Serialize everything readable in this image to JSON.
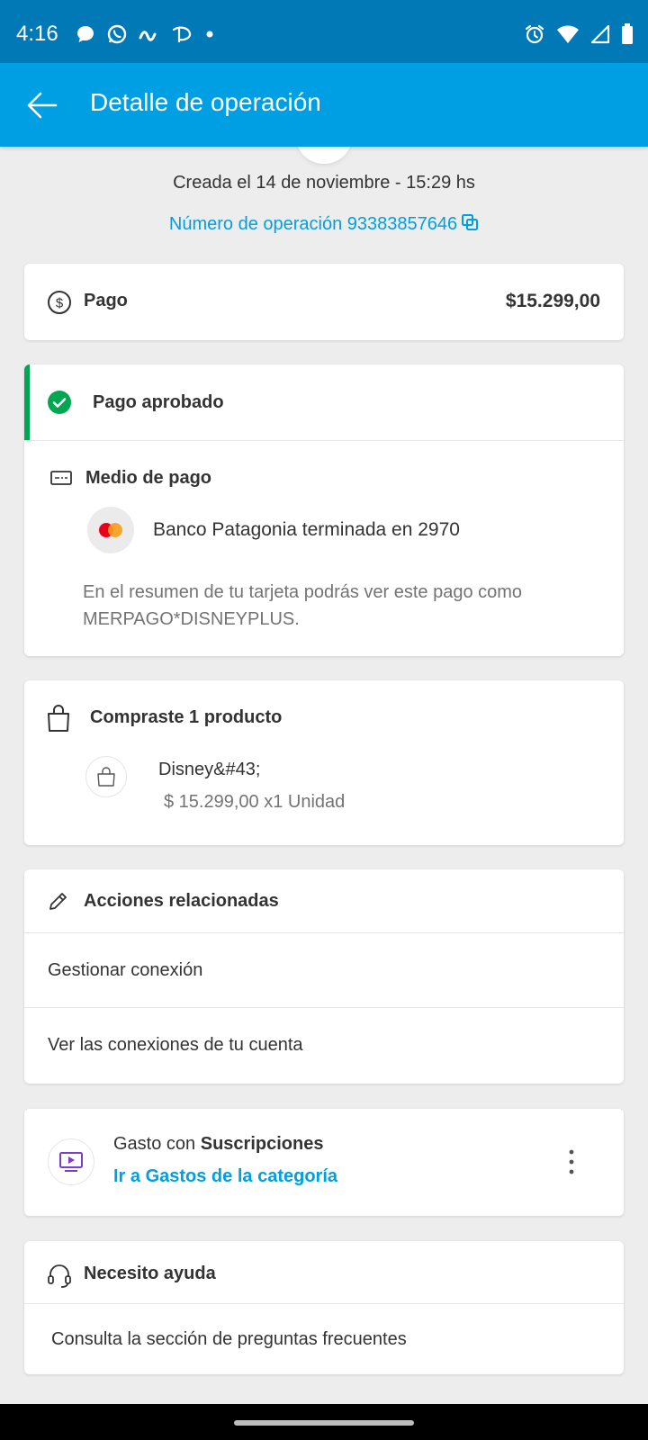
{
  "status_bar": {
    "time": "4:16",
    "left_icons": [
      "chat-bubble-icon",
      "whatsapp-icon",
      "mp-link-icon",
      "disney-plus-icon",
      "dot-icon"
    ],
    "right_icons": [
      "alarm-icon",
      "wifi-icon",
      "signal-icon",
      "battery-icon"
    ]
  },
  "app_bar": {
    "title": "Detalle de operación",
    "back_icon": "arrow-left-icon"
  },
  "header": {
    "created": "Creada el 14 de noviembre - 15:29 hs",
    "operation_number": "Número de operación 93383857646"
  },
  "payment_card": {
    "label": "Pago",
    "amount": "$15.299,00",
    "icon": "dollar-circle-icon"
  },
  "status_card": {
    "status": "Pago aprobado",
    "status_color": "#00a650",
    "method_title": "Medio de pago",
    "bank": "Banco Patagonia terminada en 2970",
    "note": "En el resumen de tu tarjeta podrás ver este pago como MERPAGO*DISNEYPLUS."
  },
  "product_card": {
    "title": "Compraste 1 producto",
    "product_name": "Disney&#43;",
    "product_price": "$ 15.299,00 x1 Unidad"
  },
  "actions_card": {
    "title": "Acciones relacionadas",
    "items": [
      "Gestionar conexión",
      "Ver las conexiones de tu cuenta"
    ]
  },
  "category_card": {
    "prefix": "Gasto con",
    "category": "Suscripciones",
    "link": "Ir a Gastos de la categoría",
    "accent": "#009ee3"
  },
  "help_card": {
    "title": "Necesito ayuda",
    "item": "Consulta la sección de preguntas frecuentes"
  }
}
